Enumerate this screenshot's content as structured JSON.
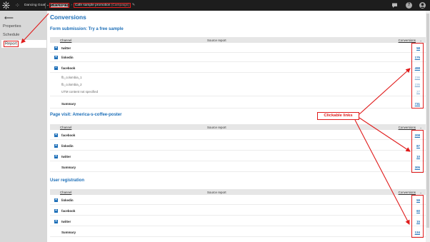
{
  "topbar": {
    "site": "Dancing Goat",
    "site_caret": "⌄",
    "crumb_link": "Campaigns",
    "crumb_arrow": "›",
    "crumb_current": "Cafe sample promotion",
    "crumb_tag": "(Campaign)",
    "edit": "✎",
    "help": "?"
  },
  "sidebar": {
    "back": "⟵",
    "items": [
      "Properties",
      "Schedule",
      "Report"
    ]
  },
  "main": {
    "title": "Conversions",
    "headers": {
      "channel": "Channel",
      "source": "Source report",
      "conversions": "Conversions",
      "sort": "⌄"
    },
    "sections": [
      {
        "title": "Form submission: Try a free sample",
        "rows": [
          {
            "label": "twitter",
            "value": "58",
            "expand": "+"
          },
          {
            "label": "linkedin",
            "value": "175",
            "expand": "+"
          },
          {
            "label": "facebook",
            "value": "498",
            "expand": "−"
          },
          {
            "label": "fb_colombia_1",
            "value": "236",
            "sub": true
          },
          {
            "label": "fb_colombia_2",
            "value": "235",
            "sub": true
          },
          {
            "label": "UTM content not specified",
            "value": "27",
            "sub": true
          },
          {
            "label": "Summary",
            "value": "731",
            "summary": true
          }
        ]
      },
      {
        "title": "Page visit: America-s-coffee-poster",
        "rows": [
          {
            "label": "facebook",
            "value": "208",
            "expand": "+"
          },
          {
            "label": "linkedin",
            "value": "87",
            "expand": "+"
          },
          {
            "label": "twitter",
            "value": "10",
            "expand": "+"
          },
          {
            "label": "Summary",
            "value": "305",
            "summary": true
          }
        ]
      },
      {
        "title": "User registration",
        "rows": [
          {
            "label": "linkedin",
            "value": "59",
            "expand": "+"
          },
          {
            "label": "facebook",
            "value": "60",
            "expand": "+"
          },
          {
            "label": "twitter",
            "value": "15",
            "expand": "+"
          },
          {
            "label": "Summary",
            "value": "134",
            "summary": true
          }
        ]
      }
    ]
  },
  "annotation": {
    "callout": "Clickable links"
  },
  "colors": {
    "accent": "#1d6fb8",
    "highlight": "#e01b1b",
    "topbar": "#1d1d1d",
    "sidebar": "#d8d8d8"
  }
}
